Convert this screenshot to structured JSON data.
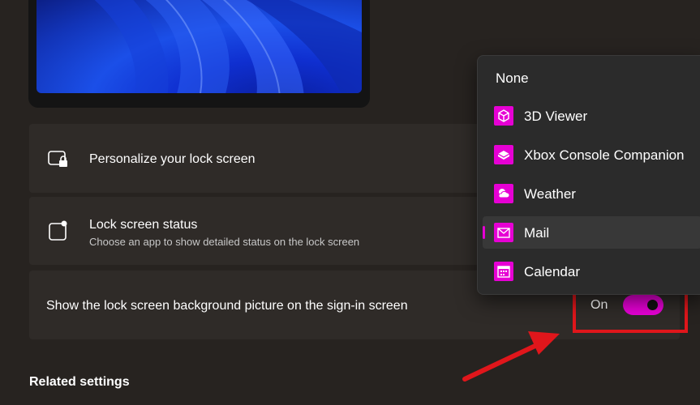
{
  "colors": {
    "background": "#272320",
    "card": "#2f2b28",
    "accent": "#e600d4",
    "annotation": "#e0161b"
  },
  "lock_screen_preview": {
    "icon": "windows-bloom-wallpaper"
  },
  "settings": {
    "personalize": {
      "title": "Personalize your lock screen",
      "icon": "lock-screen-icon"
    },
    "status": {
      "title": "Lock screen status",
      "description": "Choose an app to show detailed status on the lock screen",
      "icon": "lock-status-icon"
    },
    "background_on_signin": {
      "title": "Show the lock screen background picture on the sign-in screen",
      "toggle_label": "On",
      "toggle_on": true
    }
  },
  "dropdown": {
    "items": [
      {
        "label": "None",
        "icon": null,
        "selected": false
      },
      {
        "label": "3D Viewer",
        "icon": "cube-icon",
        "selected": false
      },
      {
        "label": "Xbox Console Companion",
        "icon": "xbox-console-icon",
        "selected": false
      },
      {
        "label": "Weather",
        "icon": "weather-icon",
        "selected": false
      },
      {
        "label": "Mail",
        "icon": "mail-icon",
        "selected": true
      },
      {
        "label": "Calendar",
        "icon": "calendar-icon",
        "selected": false
      }
    ]
  },
  "related_settings": {
    "title": "Related settings"
  }
}
